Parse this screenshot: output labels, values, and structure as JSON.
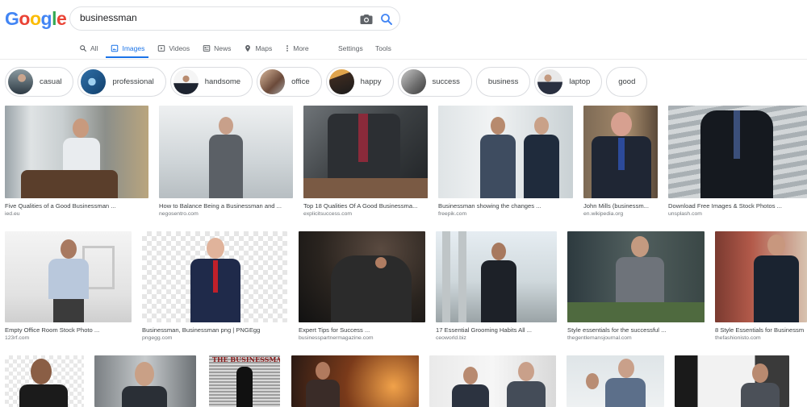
{
  "logo": {
    "letters": [
      "G",
      "o",
      "o",
      "g",
      "l",
      "e"
    ],
    "colors": [
      "#4285f4",
      "#ea4335",
      "#fbbc05",
      "#4285f4",
      "#34a853",
      "#ea4335"
    ]
  },
  "search": {
    "value": "businessman"
  },
  "icons": {
    "camera": "camera-icon",
    "search": "search-icon"
  },
  "tabs": [
    {
      "label": "All",
      "icon": "search-icon"
    },
    {
      "label": "Images",
      "icon": "image-icon"
    },
    {
      "label": "Videos",
      "icon": "video-icon"
    },
    {
      "label": "News",
      "icon": "news-icon"
    },
    {
      "label": "Maps",
      "icon": "map-pin-icon"
    },
    {
      "label": "More",
      "icon": "more-vert-icon"
    }
  ],
  "tools": {
    "settings": "Settings",
    "tools": "Tools"
  },
  "chips": [
    "casual",
    "professional",
    "handsome",
    "office",
    "happy",
    "success",
    "business",
    "laptop",
    "good"
  ],
  "results": [
    {
      "caption": "Five Qualities of a Good Businessman ...",
      "source": "ied.eu"
    },
    {
      "caption": "How to Balance Being a Businessman and ...",
      "source": "negosentro.com"
    },
    {
      "caption": "Top 18 Qualities Of A Good Businessma...",
      "source": "explicitsuccess.com"
    },
    {
      "caption": "Businessman showing the changes ...",
      "source": "freepik.com"
    },
    {
      "caption": "John Mills (businessm...",
      "source": "en.wikipedia.org"
    },
    {
      "caption": "Download Free Images & Stock Photos ...",
      "source": "unsplash.com"
    },
    {
      "caption": "Empty Office Room Stock Photo ...",
      "source": "123rf.com"
    },
    {
      "caption": "Businessman, Businessman png | PNGEgg",
      "source": "pngegg.com"
    },
    {
      "caption": "Expert Tips for Success ...",
      "source": "businesspartnermagazine.com"
    },
    {
      "caption": "17 Essential Grooming Habits All ...",
      "source": "ceoworld.biz"
    },
    {
      "caption": "Style essentials for the successful ...",
      "source": "thegentlemansjournal.com"
    },
    {
      "caption": "8 Style Essentials for Businessm",
      "source": "thefashionisto.com"
    }
  ],
  "book_title": "THE BUSINESSMAN"
}
